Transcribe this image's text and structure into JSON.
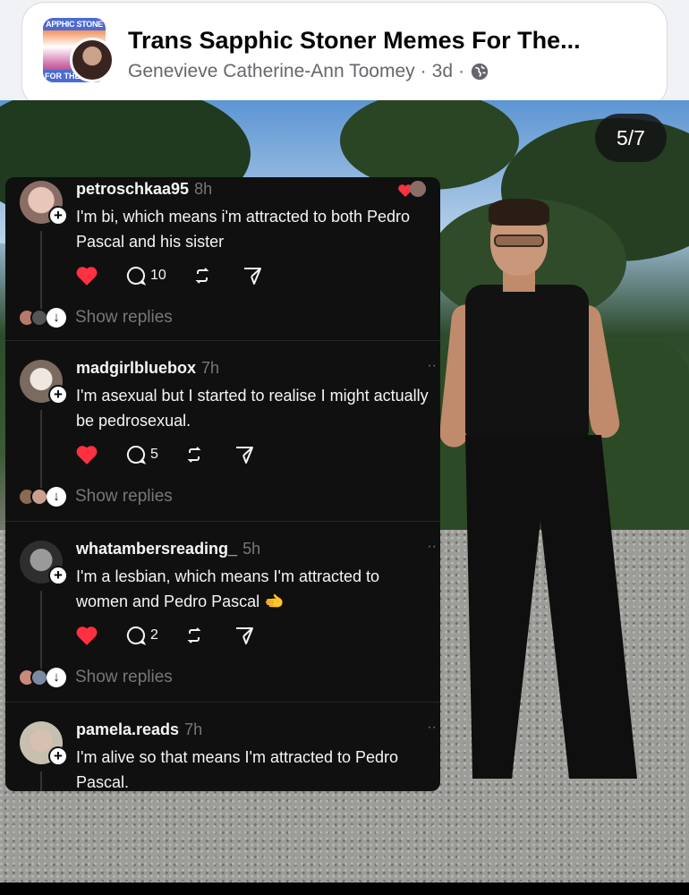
{
  "post": {
    "group_name": "Trans Sapphic Stoner Memes For The...",
    "author": "Genevieve Catherine-Ann Toomey",
    "time": "3d",
    "separator": "·",
    "group_badge_top": "APPHIC STONE",
    "group_badge_bottom": "FOR THE",
    "privacy_icon": "globe-icon"
  },
  "carousel": {
    "page_indicator": "5/7"
  },
  "comments": [
    {
      "username": "petroschkaa95",
      "time": "8h",
      "text": "I'm bi, which means i'm attracted to both Pedro Pascal and his sister",
      "replies_count": "10",
      "show_replies": "Show replies"
    },
    {
      "username": "madgirlbluebox",
      "time": "7h",
      "text": "I'm asexual but I started to realise I might actually be pedrosexual.",
      "replies_count": "5",
      "show_replies": "Show replies"
    },
    {
      "username": "whatambersreading_",
      "time": "5h",
      "text": "I'm a lesbian, which means I'm attracted to women and Pedro Pascal 🫲",
      "replies_count": "2",
      "show_replies": "Show replies"
    },
    {
      "username": "pamela.reads",
      "time": "7h",
      "text": "I'm alive so that means I'm attracted to Pedro Pascal."
    }
  ],
  "colors": {
    "header_bg": "#ffffff",
    "threads_bg": "#101010",
    "heart_red": "#ff3040",
    "meta_gray": "#65676b"
  }
}
